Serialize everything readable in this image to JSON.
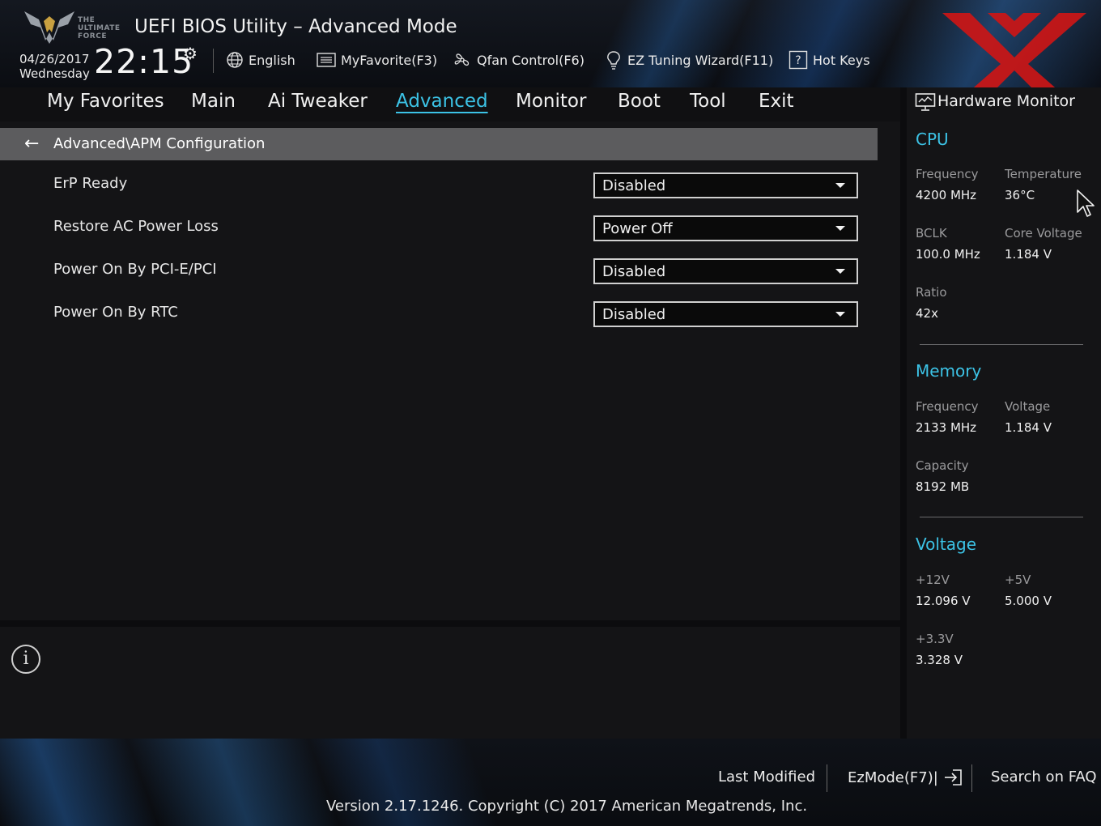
{
  "header": {
    "logo_text_lines": [
      "THE",
      "ULTIMATE",
      "FORCE"
    ],
    "title": "UEFI BIOS Utility – Advanced Mode",
    "date": "04/26/2017",
    "weekday": "Wednesday",
    "time": "22:15",
    "toolbar": {
      "language": "English",
      "favorite": "MyFavorite(F3)",
      "qfan": "Qfan Control(F6)",
      "ez_tuning": "EZ Tuning Wizard(F11)",
      "hot_keys": "Hot Keys"
    }
  },
  "nav": {
    "tabs": [
      {
        "label": "My Favorites"
      },
      {
        "label": "Main"
      },
      {
        "label": "Ai Tweaker"
      },
      {
        "label": "Advanced"
      },
      {
        "label": "Monitor"
      },
      {
        "label": "Boot"
      },
      {
        "label": "Tool"
      },
      {
        "label": "Exit"
      }
    ],
    "active": "Advanced"
  },
  "main": {
    "breadcrumb": "Advanced\\APM Configuration",
    "settings": [
      {
        "label": "ErP Ready",
        "value": "Disabled"
      },
      {
        "label": "Restore AC Power Loss",
        "value": "Power Off"
      },
      {
        "label": "Power On By PCI-E/PCI",
        "value": "Disabled"
      },
      {
        "label": "Power On By RTC",
        "value": "Disabled"
      }
    ]
  },
  "hardware_monitor": {
    "title": "Hardware Monitor",
    "cpu": {
      "heading": "CPU",
      "frequency_label": "Frequency",
      "frequency": "4200 MHz",
      "temperature_label": "Temperature",
      "temperature": "36°C",
      "bclk_label": "BCLK",
      "bclk": "100.0 MHz",
      "core_voltage_label": "Core Voltage",
      "core_voltage": "1.184 V",
      "ratio_label": "Ratio",
      "ratio": "42x"
    },
    "memory": {
      "heading": "Memory",
      "frequency_label": "Frequency",
      "frequency": "2133 MHz",
      "voltage_label": "Voltage",
      "voltage": "1.184 V",
      "capacity_label": "Capacity",
      "capacity": "8192 MB"
    },
    "voltage": {
      "heading": "Voltage",
      "v12_label": "+12V",
      "v12": "12.096 V",
      "v5_label": "+5V",
      "v5": "5.000 V",
      "v33_label": "+3.3V",
      "v33": "3.328 V"
    }
  },
  "footer": {
    "last_modified": "Last Modified",
    "ezmode": "EzMode(F7)|",
    "search_faq": "Search on FAQ",
    "version": "Version 2.17.1246. Copyright (C) 2017 American Megatrends, Inc."
  },
  "colors": {
    "accent": "#3cc3e6",
    "watermark_red": "#d01818",
    "breadcrumb_bg": "#5c5c5e"
  }
}
